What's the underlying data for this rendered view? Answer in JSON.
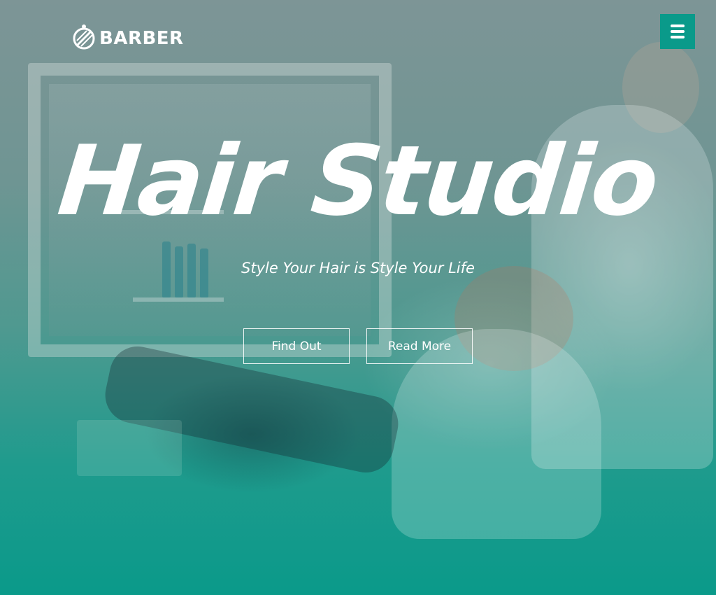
{
  "brand": {
    "logo_icon": "barber-pole-icon",
    "name": "BARBER"
  },
  "header": {
    "menu_icon": "hamburger-menu-icon"
  },
  "hero": {
    "title": "Hair Studio",
    "subtitle": "Style Your Hair is Style Your Life",
    "buttons": [
      {
        "label": "Find Out"
      },
      {
        "label": "Read More"
      }
    ]
  },
  "colors": {
    "accent": "#0a9a8a",
    "text": "#ffffff"
  }
}
